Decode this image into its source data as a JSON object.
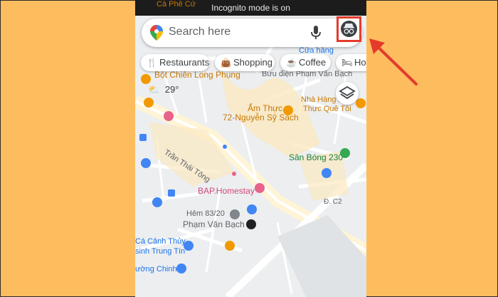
{
  "status_bar": {
    "text": "Incognito mode is on"
  },
  "search": {
    "placeholder": "Search here"
  },
  "chips": [
    "Restaurants",
    "Shopping",
    "Coffee",
    "Hote"
  ],
  "weather": {
    "temp": "29°"
  },
  "map_labels": {
    "top_cut": "Cà Phê Cứ",
    "cua_hang": "Cửa hàng",
    "bot_chien": "Bột Chiên Long Phụng",
    "buu_dien": "Bưu điện Phạm Văn Bạch",
    "am_thuc": "Ẩm Thực",
    "nguyen_sy_sach": "72-Nguyễn Sỹ Sách",
    "nha_hang_1": "Nhà Hàng X",
    "nha_hang_2": "Thực Quê Tôi",
    "tran_thai_tong": "Trần Thái Tông",
    "san_bong": "Sân Bóng 230",
    "bap_homestay": "BAP.Homestay",
    "hem": "Hẻm 83/20",
    "pham_van_bach": "Phạm Văn Bạch",
    "d_c2": "Đ. C2",
    "ca_canh_1": "Cá Cảnh Thủy",
    "ca_canh_2": "sinh Trung Tín",
    "duong_chinh": "ường Chinh"
  },
  "colors": {
    "background": "#fdbd5f",
    "highlight": "#e53b2c",
    "poi_orange": "#f29900",
    "poi_blue": "#4285f4",
    "poi_green": "#34a853",
    "poi_pink": "#e8628c"
  },
  "icons": {
    "maps_pin": "google-maps-pin-icon",
    "mic": "mic-icon",
    "incognito": "incognito-avatar-icon",
    "layers": "layers-icon"
  }
}
